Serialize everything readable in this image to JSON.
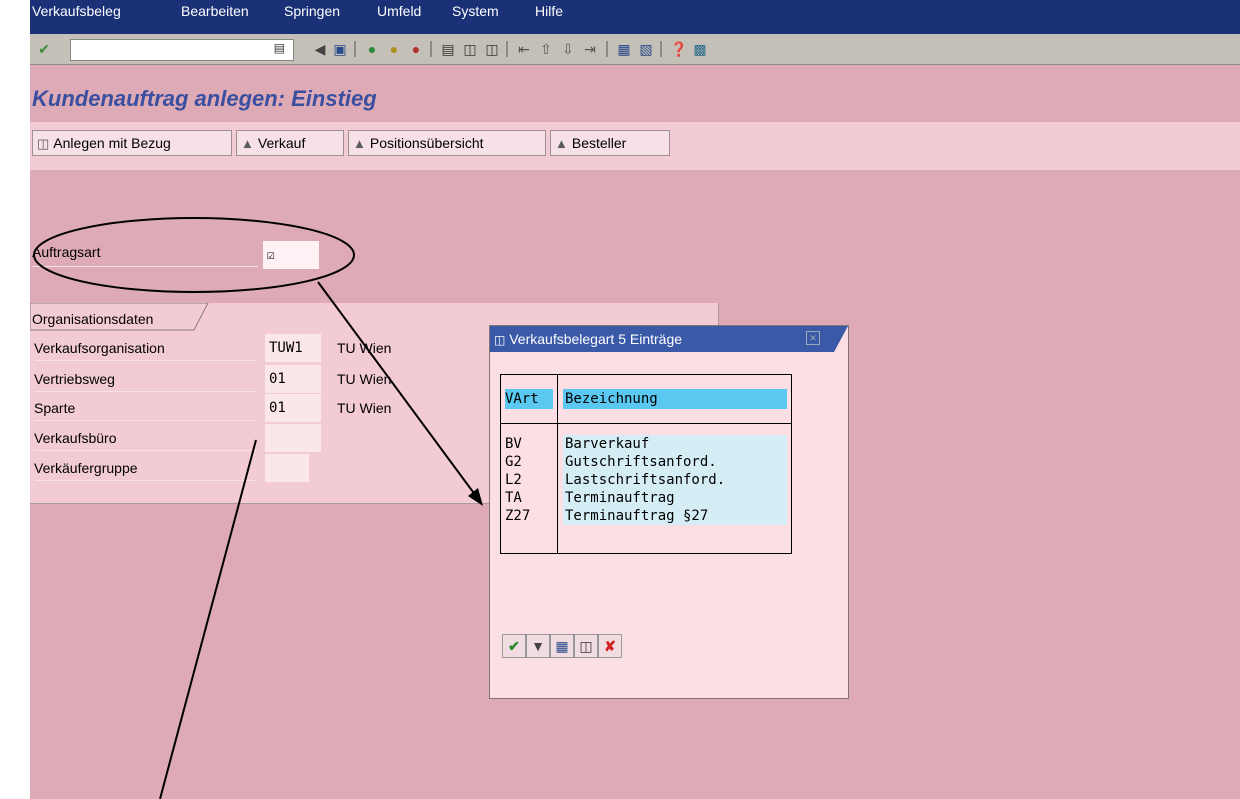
{
  "menu": [
    "Verkaufsbeleg",
    "Bearbeiten",
    "Springen",
    "Umfeld",
    "System",
    "Hilfe"
  ],
  "page_title": "Kundenauftrag anlegen: Einstieg",
  "app_buttons": [
    "Anlegen mit Bezug",
    "Verkauf",
    "Positionsübersicht",
    "Besteller"
  ],
  "form": {
    "auftragsart_label": "Auftragsart",
    "group_title": "Organisationsdaten",
    "rows": [
      {
        "label": "Verkaufsorganisation",
        "value": "TUW1",
        "desc": "TU Wien"
      },
      {
        "label": "Vertriebsweg",
        "value": "01",
        "desc": "TU Wien"
      },
      {
        "label": "Sparte",
        "value": "01",
        "desc": "TU Wien"
      },
      {
        "label": "Verkaufsbüro",
        "value": "",
        "desc": ""
      },
      {
        "label": "Verkäufergruppe",
        "value": "",
        "desc": ""
      }
    ]
  },
  "popup": {
    "title": "Verkaufsbelegart 5 Einträge",
    "columns": [
      "VArt",
      "Bezeichnung"
    ],
    "rows": [
      {
        "code": "BV",
        "name": "Barverkauf"
      },
      {
        "code": "G2",
        "name": "Gutschriftsanford."
      },
      {
        "code": "L2",
        "name": "Lastschriftsanford."
      },
      {
        "code": "TA",
        "name": "Terminauftrag"
      },
      {
        "code": "Z27",
        "name": "Terminauftrag §27"
      }
    ]
  },
  "colors": {
    "menubar": "#1a3178",
    "background": "#deaab6",
    "title": "#3b4fa0",
    "popup_titlebar": "#3a5aa8",
    "header_highlight": "#5ac8f0"
  }
}
